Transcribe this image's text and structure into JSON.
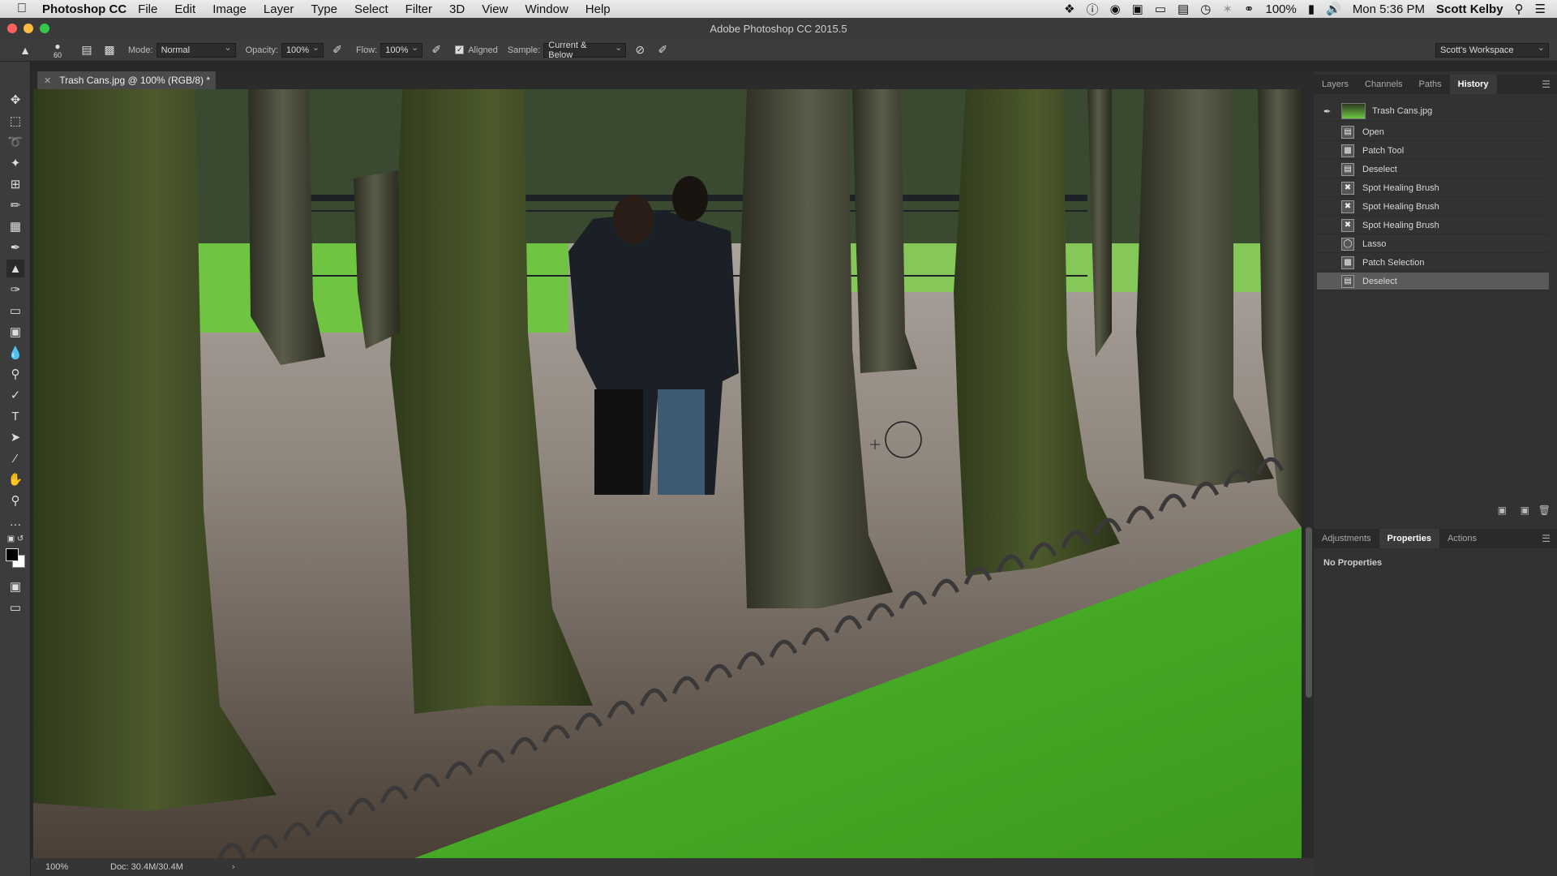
{
  "menubar": {
    "app_name": "Photoshop CC",
    "items": [
      "File",
      "Edit",
      "Image",
      "Layer",
      "Type",
      "Select",
      "Filter",
      "3D",
      "View",
      "Window",
      "Help"
    ],
    "battery": "100%",
    "clock": "Mon 5:36 PM",
    "user": "Scott Kelby"
  },
  "window": {
    "title": "Adobe Photoshop CC 2015.5"
  },
  "options": {
    "brush_size": "60",
    "mode_label": "Mode:",
    "mode_value": "Normal",
    "opacity_label": "Opacity:",
    "opacity_value": "100%",
    "flow_label": "Flow:",
    "flow_value": "100%",
    "aligned_label": "Aligned",
    "aligned_checked": true,
    "sample_label": "Sample:",
    "sample_value": "Current & Below",
    "workspace": "Scott's Workspace"
  },
  "document": {
    "tab_title": "Trash Cans.jpg @ 100% (RGB/8) *",
    "zoom": "100%",
    "doc_info": "Doc: 30.4M/30.4M"
  },
  "tools": [
    "move",
    "marquee",
    "lasso",
    "magic-wand",
    "crop",
    "eyedropper",
    "healing-brush",
    "brush",
    "clone-stamp",
    "history-brush",
    "eraser",
    "gradient",
    "blur",
    "dodge",
    "pen",
    "type",
    "path-selection",
    "line",
    "hand",
    "zoom",
    "more"
  ],
  "panels": {
    "top_tabs": [
      "Layers",
      "Channels",
      "Paths",
      "History"
    ],
    "top_active": "History",
    "history_snapshot": "Trash Cans.jpg",
    "history": [
      {
        "label": "Open",
        "icon": "document-icon"
      },
      {
        "label": "Patch Tool",
        "icon": "patch-icon"
      },
      {
        "label": "Deselect",
        "icon": "document-icon"
      },
      {
        "label": "Spot Healing Brush",
        "icon": "bandage-icon"
      },
      {
        "label": "Spot Healing Brush",
        "icon": "bandage-icon"
      },
      {
        "label": "Spot Healing Brush",
        "icon": "bandage-icon"
      },
      {
        "label": "Lasso",
        "icon": "lasso-icon"
      },
      {
        "label": "Patch Selection",
        "icon": "patch-icon"
      },
      {
        "label": "Deselect",
        "icon": "document-icon"
      }
    ],
    "history_selected_index": 8,
    "bottom_tabs": [
      "Adjustments",
      "Properties",
      "Actions"
    ],
    "bottom_active": "Properties",
    "properties_text": "No Properties"
  },
  "colors": {
    "foreground": "#000000",
    "background": "#ffffff",
    "grass": "#4fb82c"
  }
}
